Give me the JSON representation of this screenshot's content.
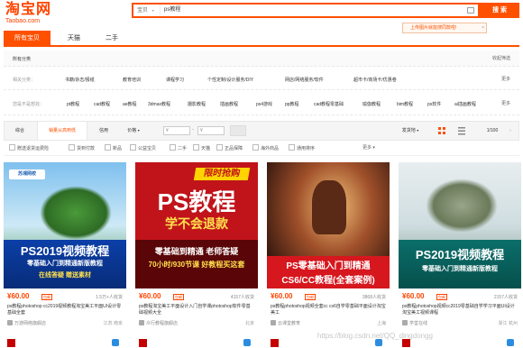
{
  "header": {
    "logo_cn": "淘宝网",
    "logo_en": "Taobao.com",
    "search_scope": "宝贝",
    "search_query": "ps教程",
    "search_button": "搜 索",
    "upload_tip": "上传图片就能搜同款啦!",
    "upload_tip_close": "×"
  },
  "tabs": [
    {
      "label": "所有宝贝"
    },
    {
      "label": "天猫"
    },
    {
      "label": "二手"
    }
  ],
  "filters": {
    "all_categories": "所有分类",
    "collapse": "收起筛选",
    "related_label": "相关分类：",
    "related": [
      "书籍/杂志/报纸",
      "教育培训",
      "课程学习",
      "个性定制/设计服务/DIY",
      "网店/网络服务/软件",
      "超市卡/商场卡/优惠卷"
    ],
    "more": "更多",
    "you_want_label": "您是不是想找：",
    "suggestions": [
      "pt教程",
      "cad教程",
      "ae教程",
      "3dmax教程",
      "摄影教程",
      "插画教程",
      "ps4游戏",
      "pp教程",
      "cad教程零基础",
      "瑜伽教程",
      "bim教程",
      "ps软件",
      "ai插画教程"
    ]
  },
  "sortbar": {
    "items": [
      "综合",
      "销量从高到低",
      "信用",
      "价格"
    ],
    "price_from": "¥",
    "price_to": "¥",
    "ship_to": "发货地",
    "page": "1/100"
  },
  "checks": [
    "赠送退货运费险",
    "货到付款",
    "新品",
    "公益宝贝",
    "二手",
    "天猫",
    "正品保障",
    "海外商品",
    "通用排序",
    "更多"
  ],
  "products": [
    {
      "price": "¥60.00",
      "tag": "包邮",
      "sales": "1.5万+人收货",
      "title": "ps教程photoshop cc2019视频教程淘宝美工平面UI设计零基础全套",
      "shop": "万游网络旗舰店",
      "location": "江苏 南京",
      "img": {
        "badge": "苏湘网校",
        "line1": "PS2019视频教程",
        "line2": "零基础入门到精通新版教程",
        "line3": "在线答疑 赠送素材"
      }
    },
    {
      "price": "¥60.00",
      "tag": "包邮",
      "sales": "4157人收货",
      "title": "ps教程淘宝美工平面设计入门自学课photoshop软件零基础视频大全",
      "shop": "众行教程旗舰店",
      "location": "北京",
      "img": {
        "badge": "限时抢购",
        "line1": "PS教程",
        "line2": "学不会退款",
        "line3": "零基础到精通 老师答疑",
        "line4": "70小时/930节课 好教程买这套"
      }
    },
    {
      "price": "¥60.00",
      "tag": "包邮",
      "sales": "3868人收货",
      "title": "ps教程photoshop视频全套cc cs6自学零基础平面设计淘宝美工",
      "shop": "云课堂教育",
      "location": "上海",
      "img": {
        "line1": "PS零基础入门到精通",
        "line2": "CS6/CC教程(全套案例)"
      }
    },
    {
      "price": "¥60.00",
      "tag": "包邮",
      "sales": "2157人收货",
      "title": "ps教程photoshop视频cc2019零基础自学学习平面UI设计淘宝美工视频课程",
      "shop": "学堂在线",
      "location": "浙江 杭州",
      "img": {
        "line1": "PS2019视频教程",
        "line2": "零基础入门到精通新版教程"
      }
    }
  ],
  "watermark": "https://blog.csdn.net/QQ_dingdongg",
  "colors": {
    "brand": "#ff5000",
    "price": "#ff4400",
    "tmall": "#c40000"
  }
}
